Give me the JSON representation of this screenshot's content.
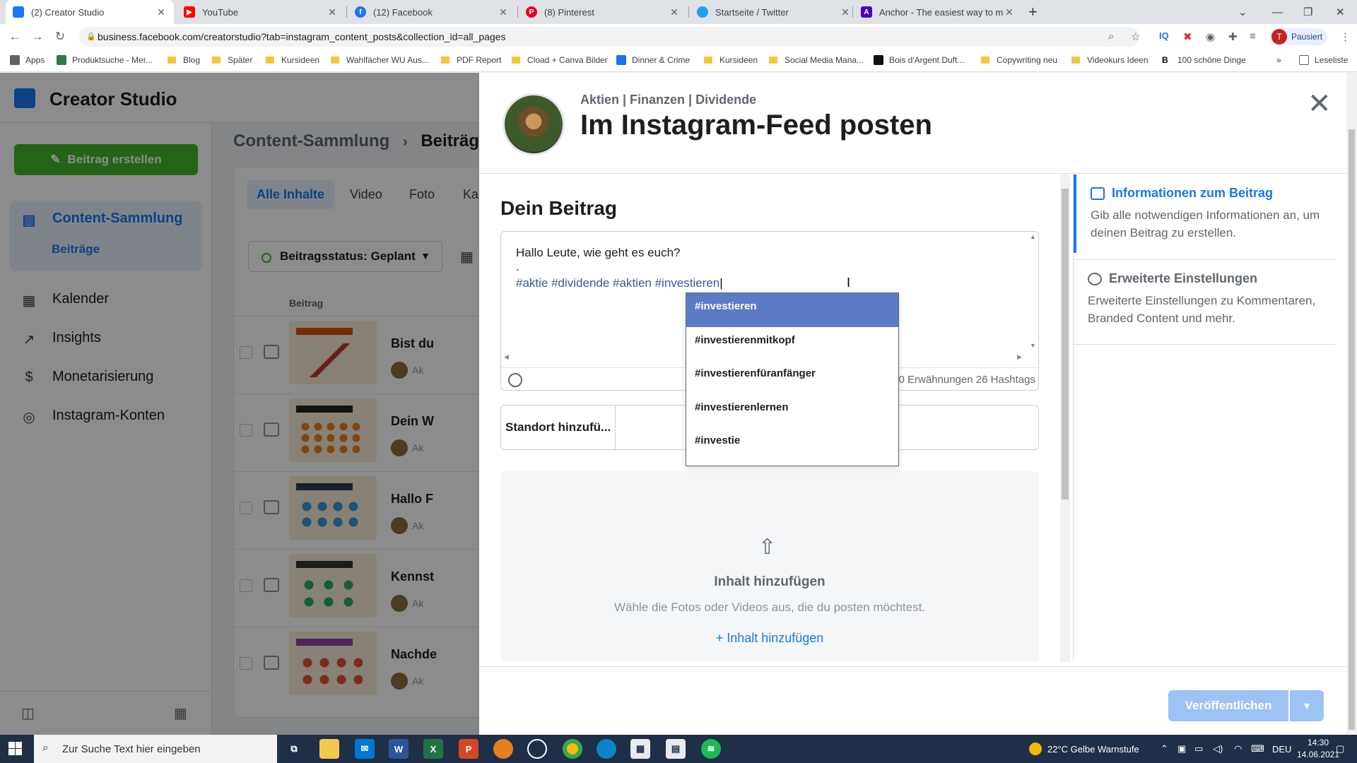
{
  "browser": {
    "tabs": [
      {
        "title": "(2) Creator Studio",
        "icon": "creator-studio-icon",
        "color": "#1877f2",
        "active": true
      },
      {
        "title": "YouTube",
        "icon": "youtube-icon",
        "color": "#ff0000"
      },
      {
        "title": "(12) Facebook",
        "icon": "facebook-icon",
        "color": "#1877f2"
      },
      {
        "title": "(8) Pinterest",
        "icon": "pinterest-icon",
        "color": "#e60023"
      },
      {
        "title": "Startseite / Twitter",
        "icon": "twitter-icon",
        "color": "#1da1f2"
      },
      {
        "title": "Anchor - The easiest way to mak",
        "icon": "anchor-icon",
        "color": "#5000b9"
      }
    ],
    "url": "business.facebook.com/creatorstudio?tab=instagram_content_posts&collection_id=all_pages",
    "profile_label": "Pausiert",
    "profile_initial": "T",
    "bookmarks": [
      "Apps",
      "Produktsuche - Mer...",
      "Blog",
      "Später",
      "Kursideen",
      "Wahlfächer WU Aus...",
      "PDF Report",
      "Cload + Canva Bilder",
      "Dinner & Crime",
      "Kursideen",
      "Social Media Mana...",
      "Bois d'Argent Duft...",
      "Copywriting neu",
      "Videokurs Ideen",
      "100 schöne Dinge"
    ],
    "reading_list": "Leseliste"
  },
  "creator_studio": {
    "title": "Creator Studio",
    "create_button": "Beitrag erstellen",
    "nav": {
      "content": "Content-Sammlung",
      "content_sub": "Beiträge",
      "calendar": "Kalender",
      "insights": "Insights",
      "monetization": "Monetarisierung",
      "accounts": "Instagram-Konten"
    },
    "breadcrumb_root": "Content-Sammlung",
    "breadcrumb_current": "Beiträge",
    "filter_tabs": [
      "Alle Inhalte",
      "Video",
      "Foto",
      "Ka"
    ],
    "status_filter": "Beitragsstatus: Geplant",
    "column_post": "Beitrag",
    "posts": [
      {
        "title": "Bist du",
        "account": "Ak"
      },
      {
        "title": "Dein W",
        "account": "Ak"
      },
      {
        "title": "Hallo F",
        "account": "Ak"
      },
      {
        "title": "Kennst",
        "account": "Ak"
      },
      {
        "title": "Nachde",
        "account": "Ak"
      }
    ]
  },
  "modal": {
    "account": "Aktien | Finanzen | Dividende",
    "title": "Im Instagram-Feed posten",
    "section_title": "Dein Beitrag",
    "caption": {
      "line1": "Hallo Leute, wie geht es euch?",
      "line2": ".",
      "hashtags": "#aktie #dividende #aktien #investieren"
    },
    "counts": "0 Erwähnungen 26 Hashtags",
    "location_label": "Standort hinzufü...",
    "suggestions": [
      "#investieren",
      "#investierenmitkopf",
      "#investierenfüranfänger",
      "#investierenlernen",
      "#investie"
    ],
    "upload": {
      "title": "Inhalt hinzufügen",
      "description": "Wähle die Fotos oder Videos aus, die du posten möchtest.",
      "link": "Inhalt hinzufügen"
    },
    "right": {
      "info_title": "Informationen zum Beitrag",
      "info_desc": "Gib alle notwendigen Informationen an, um deinen Beitrag zu erstellen.",
      "advanced_title": "Erweiterte Einstellungen",
      "advanced_desc": "Erweiterte Einstellungen zu Kommentaren, Branded Content und mehr."
    },
    "publish_button": "Veröffentlichen"
  },
  "taskbar": {
    "search_placeholder": "Zur Suche Text hier eingeben",
    "weather": "22°C Gelbe Warnstufe",
    "language": "DEU",
    "time": "14:30",
    "date": "14.06.2021"
  }
}
